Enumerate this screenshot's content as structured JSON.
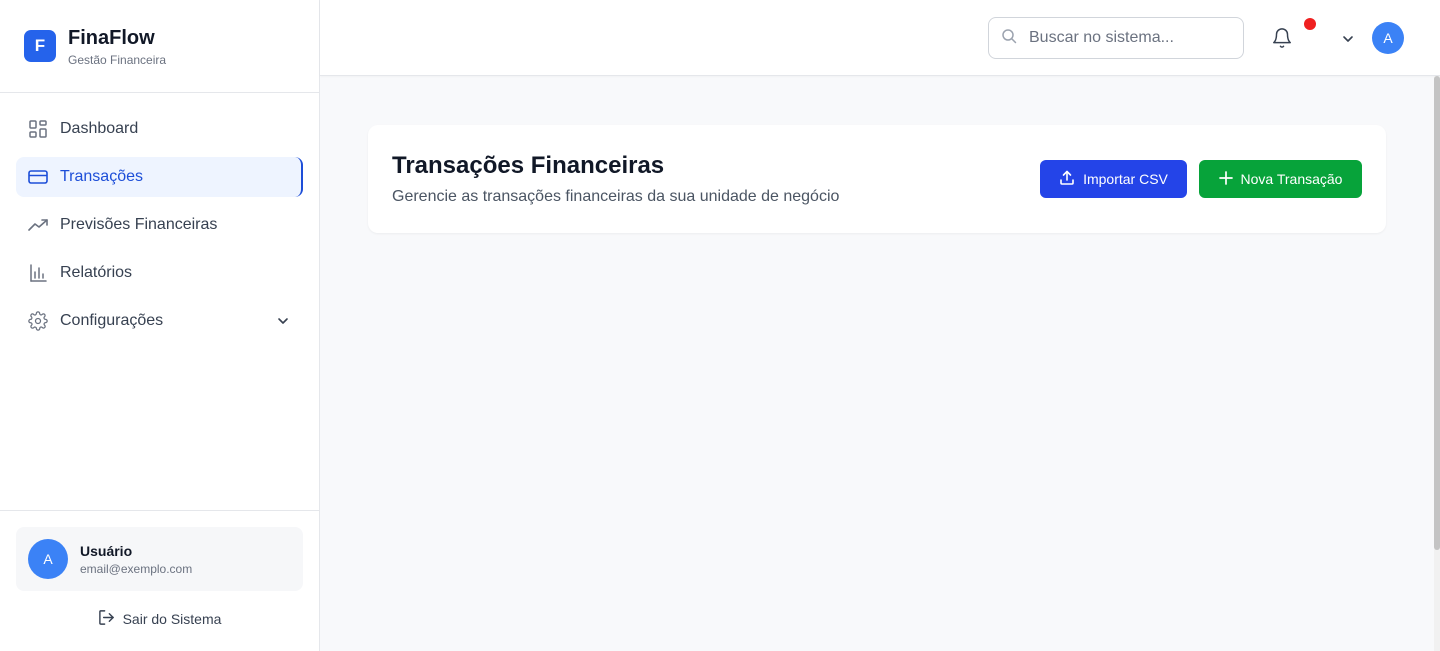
{
  "brand": {
    "logo_letter": "F",
    "name": "FinaFlow",
    "subtitle": "Gestão Financeira",
    "accent": "#2563eb"
  },
  "sidebar": {
    "items": [
      {
        "label": "Dashboard",
        "icon": "dashboard-grid-icon",
        "active": false
      },
      {
        "label": "Transações",
        "icon": "credit-card-icon",
        "active": true
      },
      {
        "label": "Previsões Financeiras",
        "icon": "trending-up-icon",
        "active": false
      },
      {
        "label": "Relatórios",
        "icon": "bar-chart-icon",
        "active": false
      },
      {
        "label": "Configurações",
        "icon": "gear-icon",
        "active": false,
        "expandable": true
      }
    ]
  },
  "user": {
    "avatar_letter": "A",
    "name": "Usuário",
    "email": "email@exemplo.com",
    "logout_label": "Sair do Sistema"
  },
  "header": {
    "search_placeholder": "Buscar no sistema...",
    "avatar_letter": "A",
    "notification_dot_color": "#ef2020"
  },
  "main": {
    "title": "Transações Financeiras",
    "subtitle": "Gerencie as transações financeiras da sua unidade de negócio",
    "import_label": "Importar CSV",
    "new_label": "Nova Transação",
    "import_color": "#2444e8",
    "new_color": "#07a33a"
  }
}
